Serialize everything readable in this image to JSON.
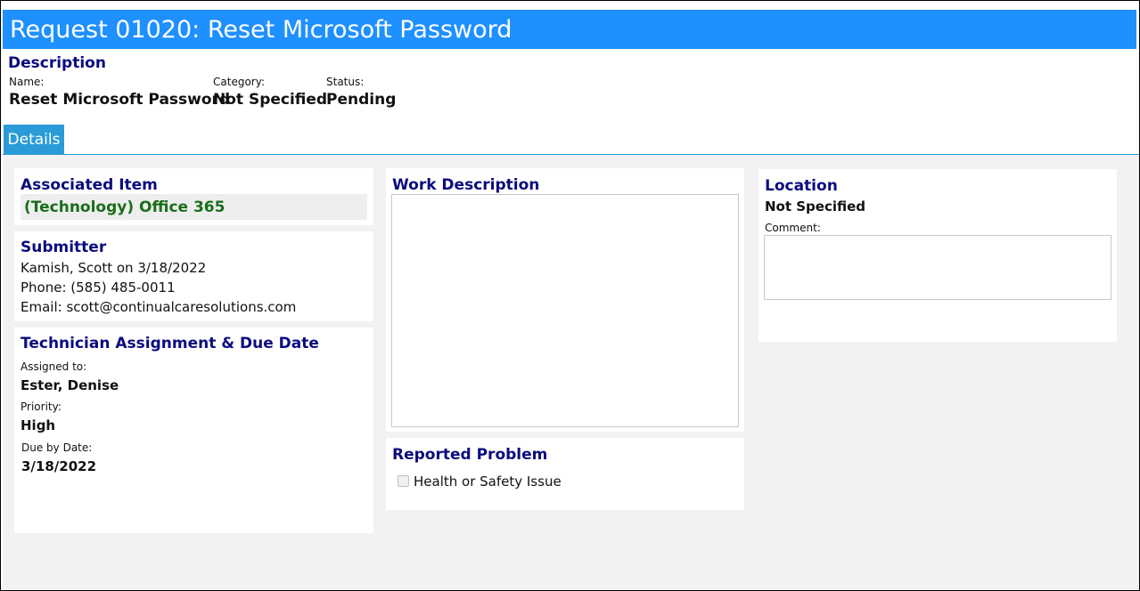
{
  "header": {
    "title": "Request 01020: Reset Microsoft Password"
  },
  "description": {
    "heading": "Description",
    "name_label": "Name:",
    "name_value": "Reset Microsoft Password",
    "category_label": "Category:",
    "category_value": "Not Specified",
    "status_label": "Status:",
    "status_value": "Pending"
  },
  "tabs": [
    {
      "label": "Details",
      "active": true
    }
  ],
  "associated_item": {
    "heading": "Associated Item",
    "value": "(Technology) Office 365"
  },
  "submitter": {
    "heading": "Submitter",
    "line1": "Kamish, Scott on 3/18/2022",
    "phone": "Phone: (585) 485-0011",
    "email": "Email: scott@continualcaresolutions.com"
  },
  "technician": {
    "heading": "Technician Assignment & Due Date",
    "assigned_label": "Assigned to:",
    "assigned_value": "Ester, Denise",
    "priority_label": "Priority:",
    "priority_value": "High",
    "due_label": "Due by Date:",
    "due_value": "3/18/2022"
  },
  "work_description": {
    "heading": "Work Description",
    "value": ""
  },
  "reported_problem": {
    "heading": "Reported Problem",
    "checkbox_label": "Health or Safety Issue",
    "checked": false
  },
  "location": {
    "heading": "Location",
    "value": "Not Specified",
    "comment_label": "Comment:",
    "comment_value": ""
  },
  "colors": {
    "title_bar": "#1e90ff",
    "tab": "#2a9bd6",
    "heading": "#0b0b80",
    "associated_item_text": "#1a6e1a",
    "workspace_bg": "#f2f2f2"
  }
}
